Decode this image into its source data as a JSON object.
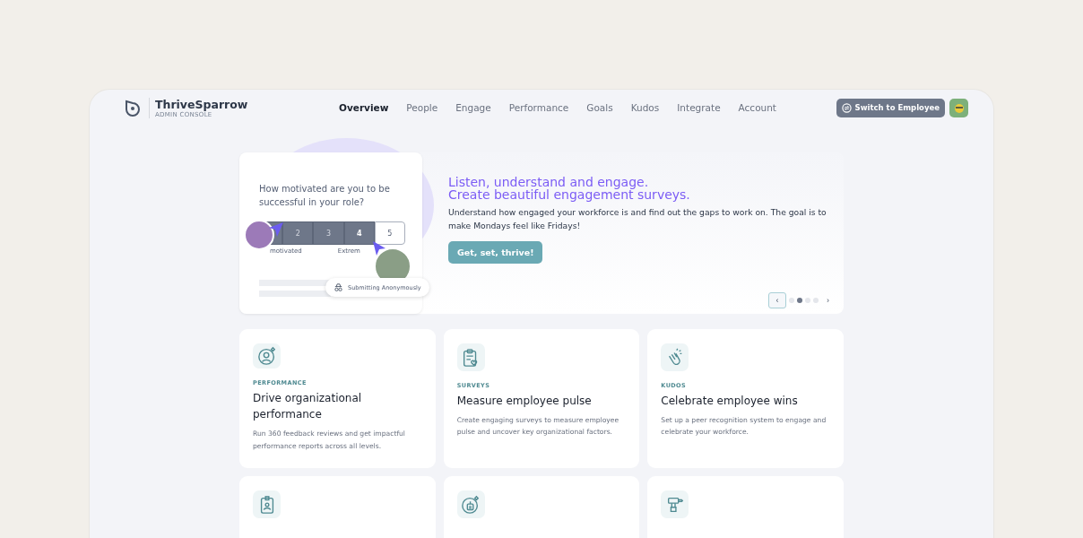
{
  "brand": {
    "name": "ThriveSparrow",
    "subtitle": "ADMIN CONSOLE"
  },
  "nav": [
    {
      "label": "Overview",
      "selected": true
    },
    {
      "label": "People",
      "selected": false
    },
    {
      "label": "Engage",
      "selected": false
    },
    {
      "label": "Performance",
      "selected": false
    },
    {
      "label": "Goals",
      "selected": false
    },
    {
      "label": "Kudos",
      "selected": false
    },
    {
      "label": "Integrate",
      "selected": false
    },
    {
      "label": "Account",
      "selected": false
    }
  ],
  "switch_button": "Switch to Employee",
  "hero": {
    "survey": {
      "question": "How motivated are you to be successful in your role?",
      "scale": [
        {
          "selected": true
        },
        {
          "label": "2",
          "selected": true
        },
        {
          "label": "3",
          "selected": true
        },
        {
          "label": "4",
          "selected": true
        },
        {
          "label": "5",
          "selected": false
        }
      ],
      "low_label": "motivated",
      "high_label": "Extrem",
      "badge": "Submitting Anonymously"
    },
    "title_lines": [
      "Listen, understand and engage.",
      "Create beautiful engagement surveys."
    ],
    "text": "Understand how engaged your workforce is and find out the gaps to work on. The goal is to make Mondays feel like Fridays!",
    "button": "Get, set, thrive!",
    "prev": "‹",
    "next": "›",
    "dots": [
      {
        "selected": false
      },
      {
        "selected": true
      },
      {
        "selected": false
      },
      {
        "selected": false
      }
    ]
  },
  "cards": [
    {
      "tag": "PERFORMANCE",
      "title": "Drive organizational performance",
      "text": "Run 360 feedback reviews and get impactful performance reports across all levels."
    },
    {
      "tag": "SURVEYS",
      "title": "Measure employee pulse",
      "text": "Create engaging surveys to measure employee pulse and uncover key organizational factors."
    },
    {
      "tag": "KUDOS",
      "title": "Celebrate employee wins",
      "text": "Set up a peer recognition system to engage and celebrate your workforce."
    }
  ]
}
